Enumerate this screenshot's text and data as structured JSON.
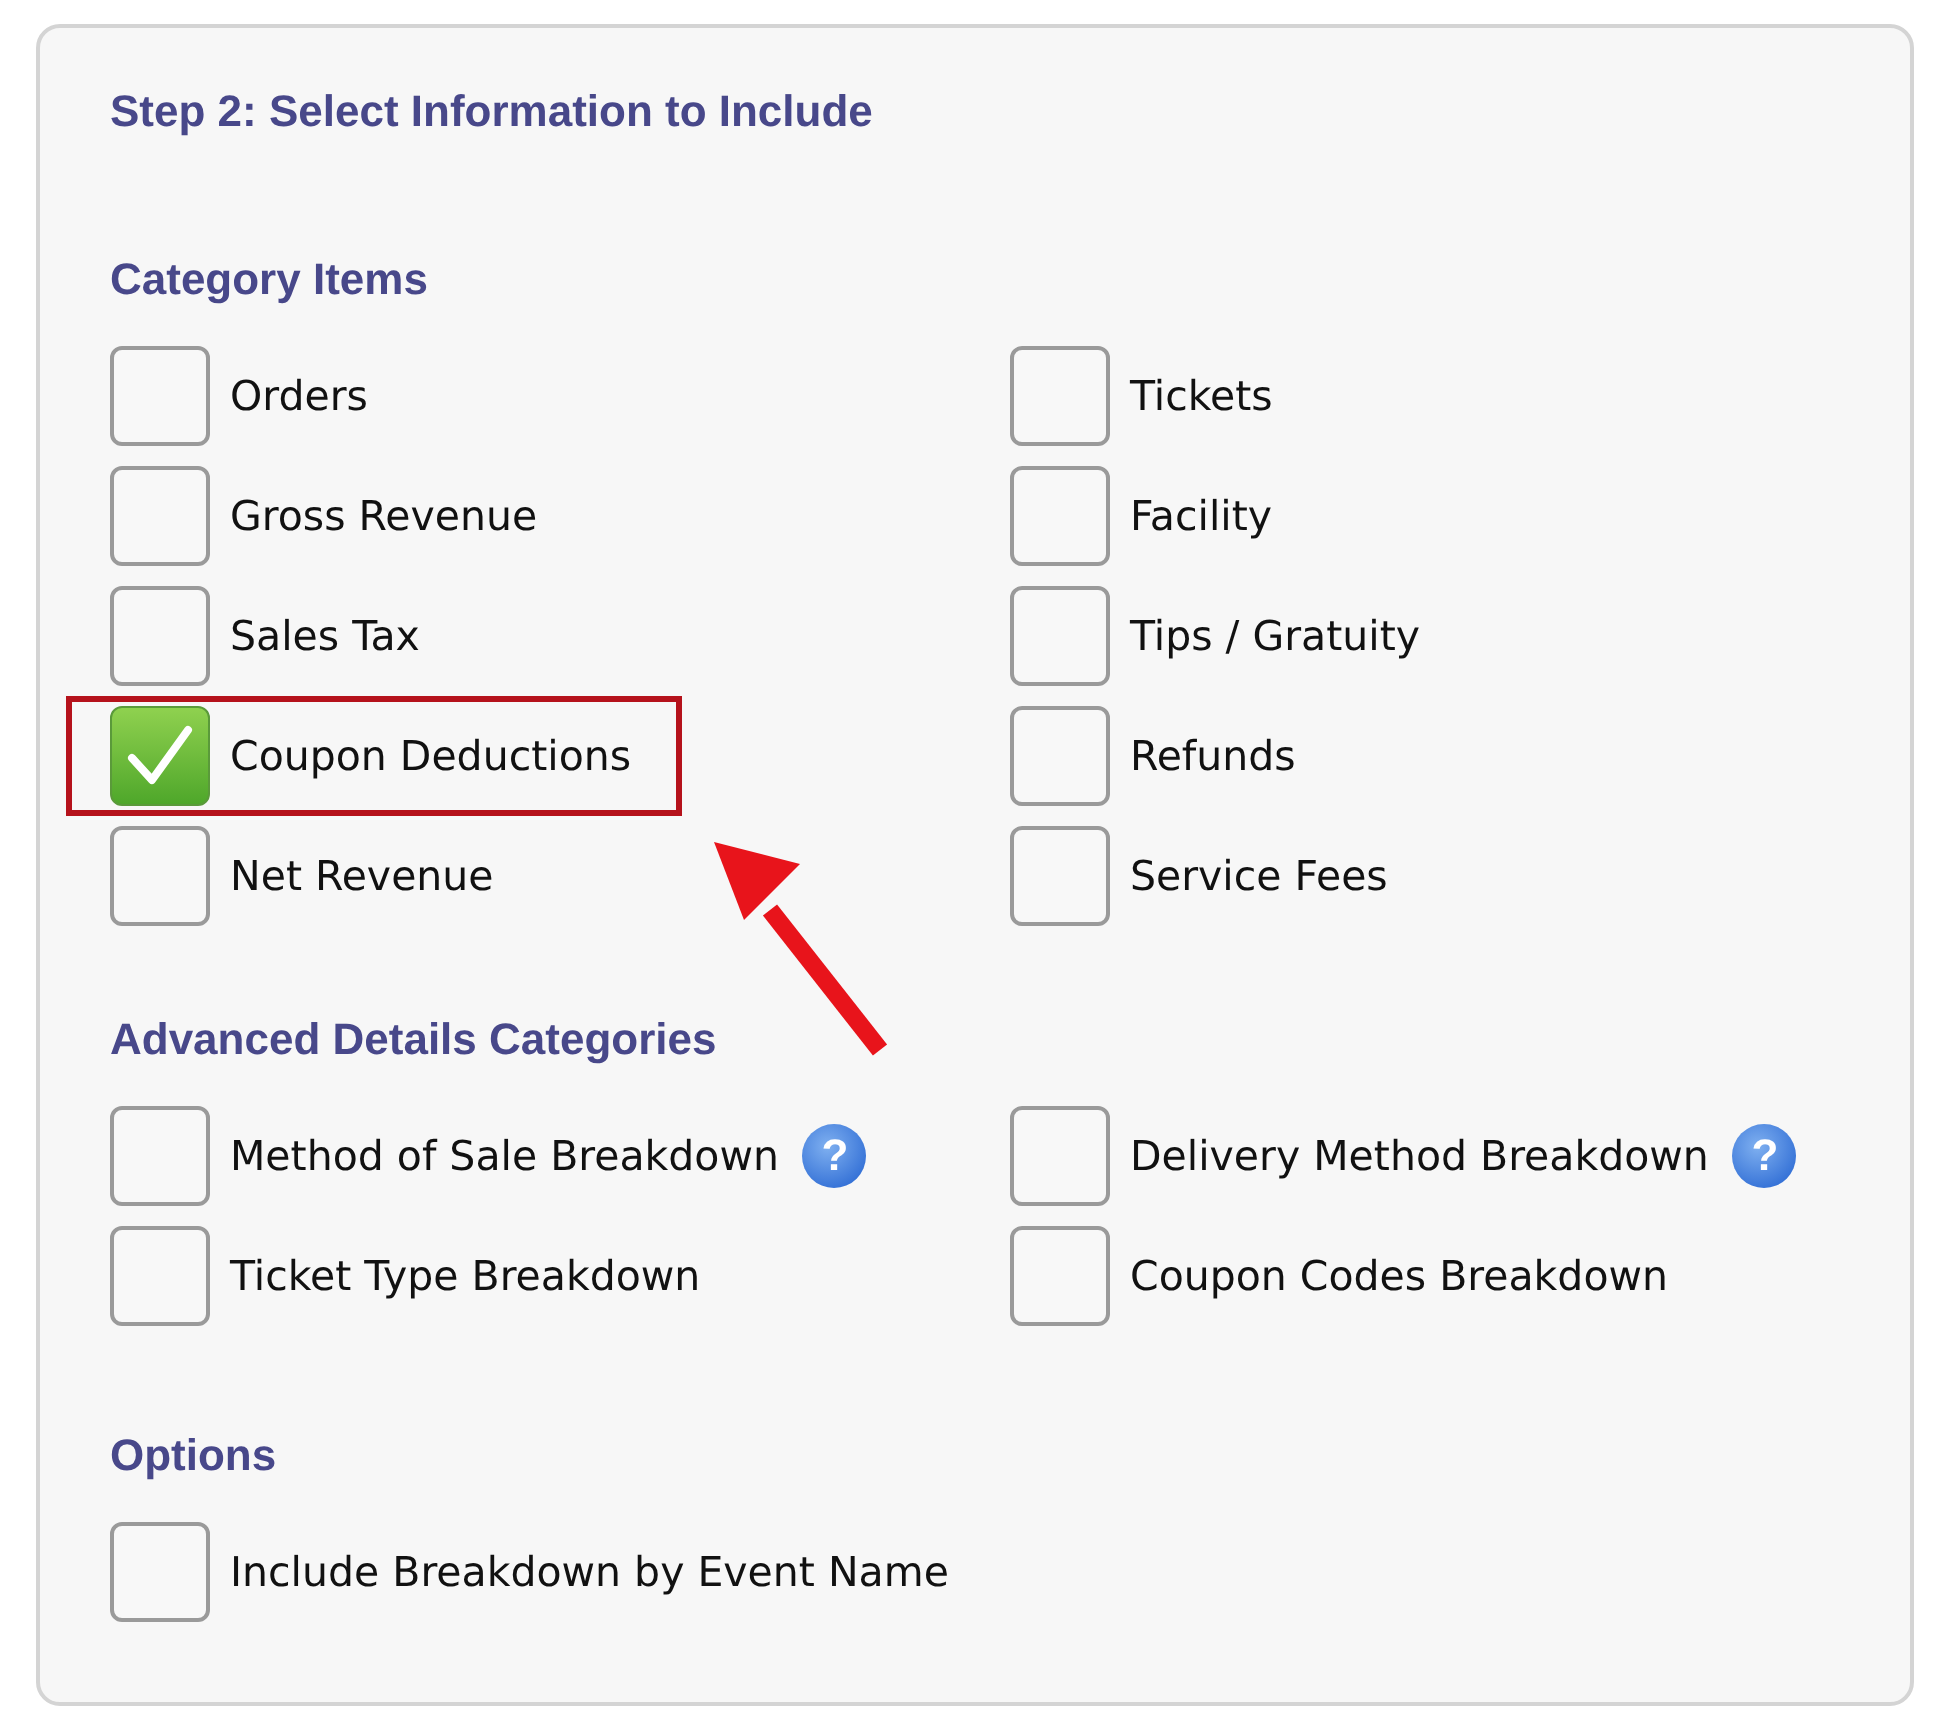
{
  "title": "Step 2: Select Information to Include",
  "sections": [
    {
      "heading": "Category Items",
      "items": [
        {
          "label": "Orders",
          "checked": false,
          "highlighted": false
        },
        {
          "label": "Tickets",
          "checked": false,
          "highlighted": false
        },
        {
          "label": "Gross Revenue",
          "checked": false,
          "highlighted": false
        },
        {
          "label": "Facility",
          "checked": false,
          "highlighted": false
        },
        {
          "label": "Sales Tax",
          "checked": false,
          "highlighted": false
        },
        {
          "label": "Tips / Gratuity",
          "checked": false,
          "highlighted": false
        },
        {
          "label": "Coupon Deductions",
          "checked": true,
          "highlighted": true
        },
        {
          "label": "Refunds",
          "checked": false,
          "highlighted": false
        },
        {
          "label": "Net Revenue",
          "checked": false,
          "highlighted": false
        },
        {
          "label": "Service Fees",
          "checked": false,
          "highlighted": false
        }
      ]
    },
    {
      "heading": "Advanced Details Categories",
      "items": [
        {
          "label": "Method of Sale Breakdown",
          "checked": false,
          "highlighted": false,
          "help": "?"
        },
        {
          "label": "Delivery Method Breakdown",
          "checked": false,
          "highlighted": false,
          "help": "?"
        },
        {
          "label": "Ticket Type Breakdown",
          "checked": false,
          "highlighted": false
        },
        {
          "label": "Coupon Codes Breakdown",
          "checked": false,
          "highlighted": false
        }
      ]
    },
    {
      "heading": "Options",
      "items": [
        {
          "label": "Include Breakdown by Event Name",
          "checked": false,
          "highlighted": false
        }
      ]
    }
  ]
}
